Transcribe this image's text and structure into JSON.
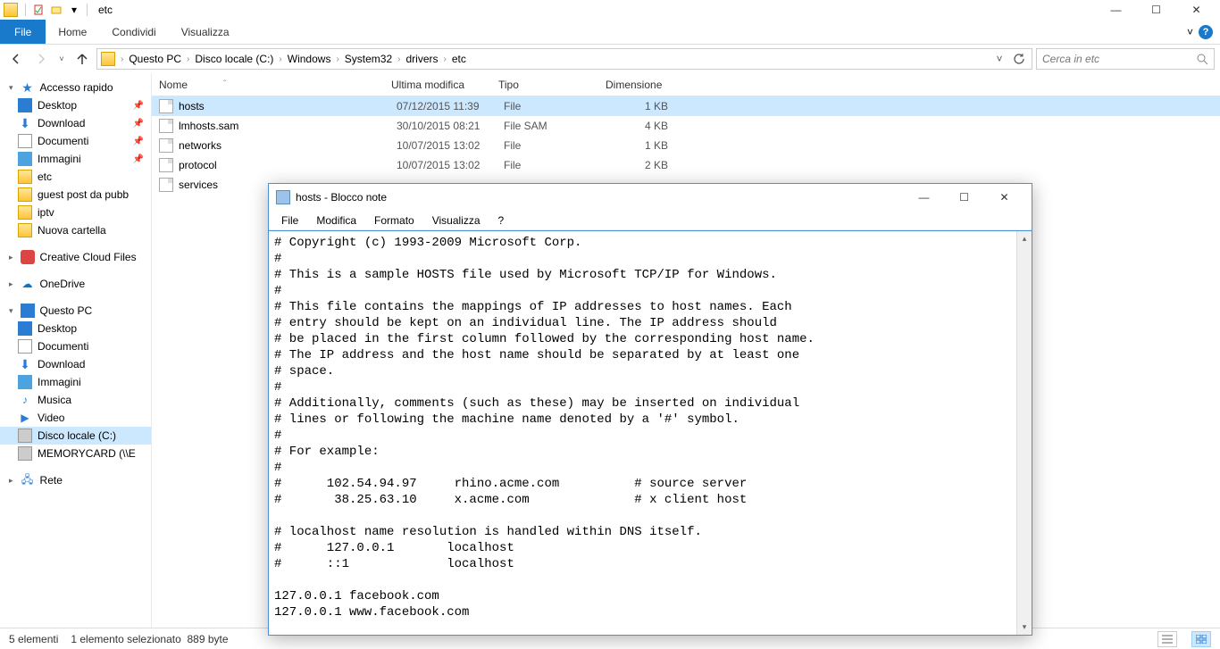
{
  "window": {
    "title": "etc",
    "controls": {
      "min": "—",
      "max": "☐",
      "close": "✕"
    }
  },
  "ribbon": {
    "file": "File",
    "tabs": [
      "Home",
      "Condividi",
      "Visualizza"
    ],
    "expand": "˅"
  },
  "nav": {
    "back": "←",
    "forward": "→",
    "recent": "˅",
    "up": "↑",
    "refresh": "↻",
    "dropdown": "˅"
  },
  "breadcrumbs": [
    "Questo PC",
    "Disco locale (C:)",
    "Windows",
    "System32",
    "drivers",
    "etc"
  ],
  "search": {
    "placeholder": "Cerca in etc"
  },
  "columns": {
    "name": "Nome",
    "date": "Ultima modifica",
    "type": "Tipo",
    "size": "Dimensione",
    "sort": "ˆ"
  },
  "files": [
    {
      "name": "hosts",
      "date": "07/12/2015 11:39",
      "type": "File",
      "size": "1 KB",
      "selected": true
    },
    {
      "name": "lmhosts.sam",
      "date": "30/10/2015 08:21",
      "type": "File SAM",
      "size": "4 KB",
      "selected": false
    },
    {
      "name": "networks",
      "date": "10/07/2015 13:02",
      "type": "File",
      "size": "1 KB",
      "selected": false
    },
    {
      "name": "protocol",
      "date": "10/07/2015 13:02",
      "type": "File",
      "size": "2 KB",
      "selected": false
    },
    {
      "name": "services",
      "date": "",
      "type": "",
      "size": "",
      "selected": false
    }
  ],
  "sidebar": {
    "quick_access": {
      "label": "Accesso rapido",
      "items": [
        {
          "label": "Desktop",
          "pinned": true
        },
        {
          "label": "Download",
          "pinned": true
        },
        {
          "label": "Documenti",
          "pinned": true
        },
        {
          "label": "Immagini",
          "pinned": true
        },
        {
          "label": "etc",
          "pinned": false
        },
        {
          "label": "guest post da pubb",
          "pinned": false
        },
        {
          "label": "iptv",
          "pinned": false
        },
        {
          "label": "Nuova cartella",
          "pinned": false
        }
      ]
    },
    "cc": "Creative Cloud Files",
    "onedrive": "OneDrive",
    "thispc": {
      "label": "Questo PC",
      "items": [
        "Desktop",
        "Documenti",
        "Download",
        "Immagini",
        "Musica",
        "Video",
        "Disco locale (C:)",
        "MEMORYCARD (\\\\E"
      ]
    },
    "network": "Rete"
  },
  "status": {
    "count": "5 elementi",
    "selection": "1 elemento selezionato",
    "size": "889 byte"
  },
  "notepad": {
    "title": "hosts - Blocco note",
    "menu": [
      "File",
      "Modifica",
      "Formato",
      "Visualizza",
      "?"
    ],
    "content": "# Copyright (c) 1993-2009 Microsoft Corp.\n#\n# This is a sample HOSTS file used by Microsoft TCP/IP for Windows.\n#\n# This file contains the mappings of IP addresses to host names. Each\n# entry should be kept on an individual line. The IP address should\n# be placed in the first column followed by the corresponding host name.\n# The IP address and the host name should be separated by at least one\n# space.\n#\n# Additionally, comments (such as these) may be inserted on individual\n# lines or following the machine name denoted by a '#' symbol.\n#\n# For example:\n#\n#      102.54.94.97     rhino.acme.com          # source server\n#       38.25.63.10     x.acme.com              # x client host\n\n# localhost name resolution is handled within DNS itself.\n#      127.0.0.1       localhost\n#      ::1             localhost\n\n127.0.0.1 facebook.com\n127.0.0.1 www.facebook.com"
  }
}
